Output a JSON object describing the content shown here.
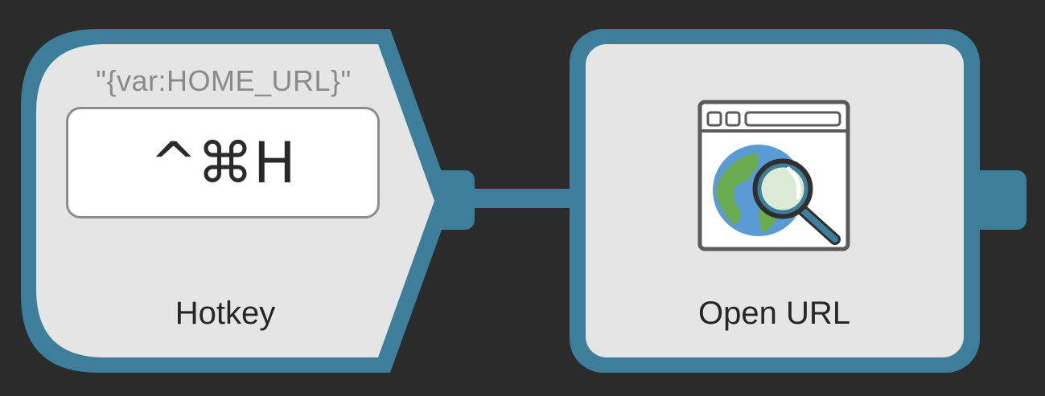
{
  "workflow": {
    "trigger": {
      "type_label": "Hotkey",
      "argument": "\"{var:HOME_URL}\"",
      "hotkey": "^⌘H"
    },
    "action": {
      "type_label": "Open URL",
      "icon": "browser-globe-search-icon"
    }
  },
  "colors": {
    "background": "#2b2b2b",
    "node_border": "#3d7f9b",
    "node_fill": "#e5e5e5",
    "hotkey_field": "#ffffff"
  }
}
